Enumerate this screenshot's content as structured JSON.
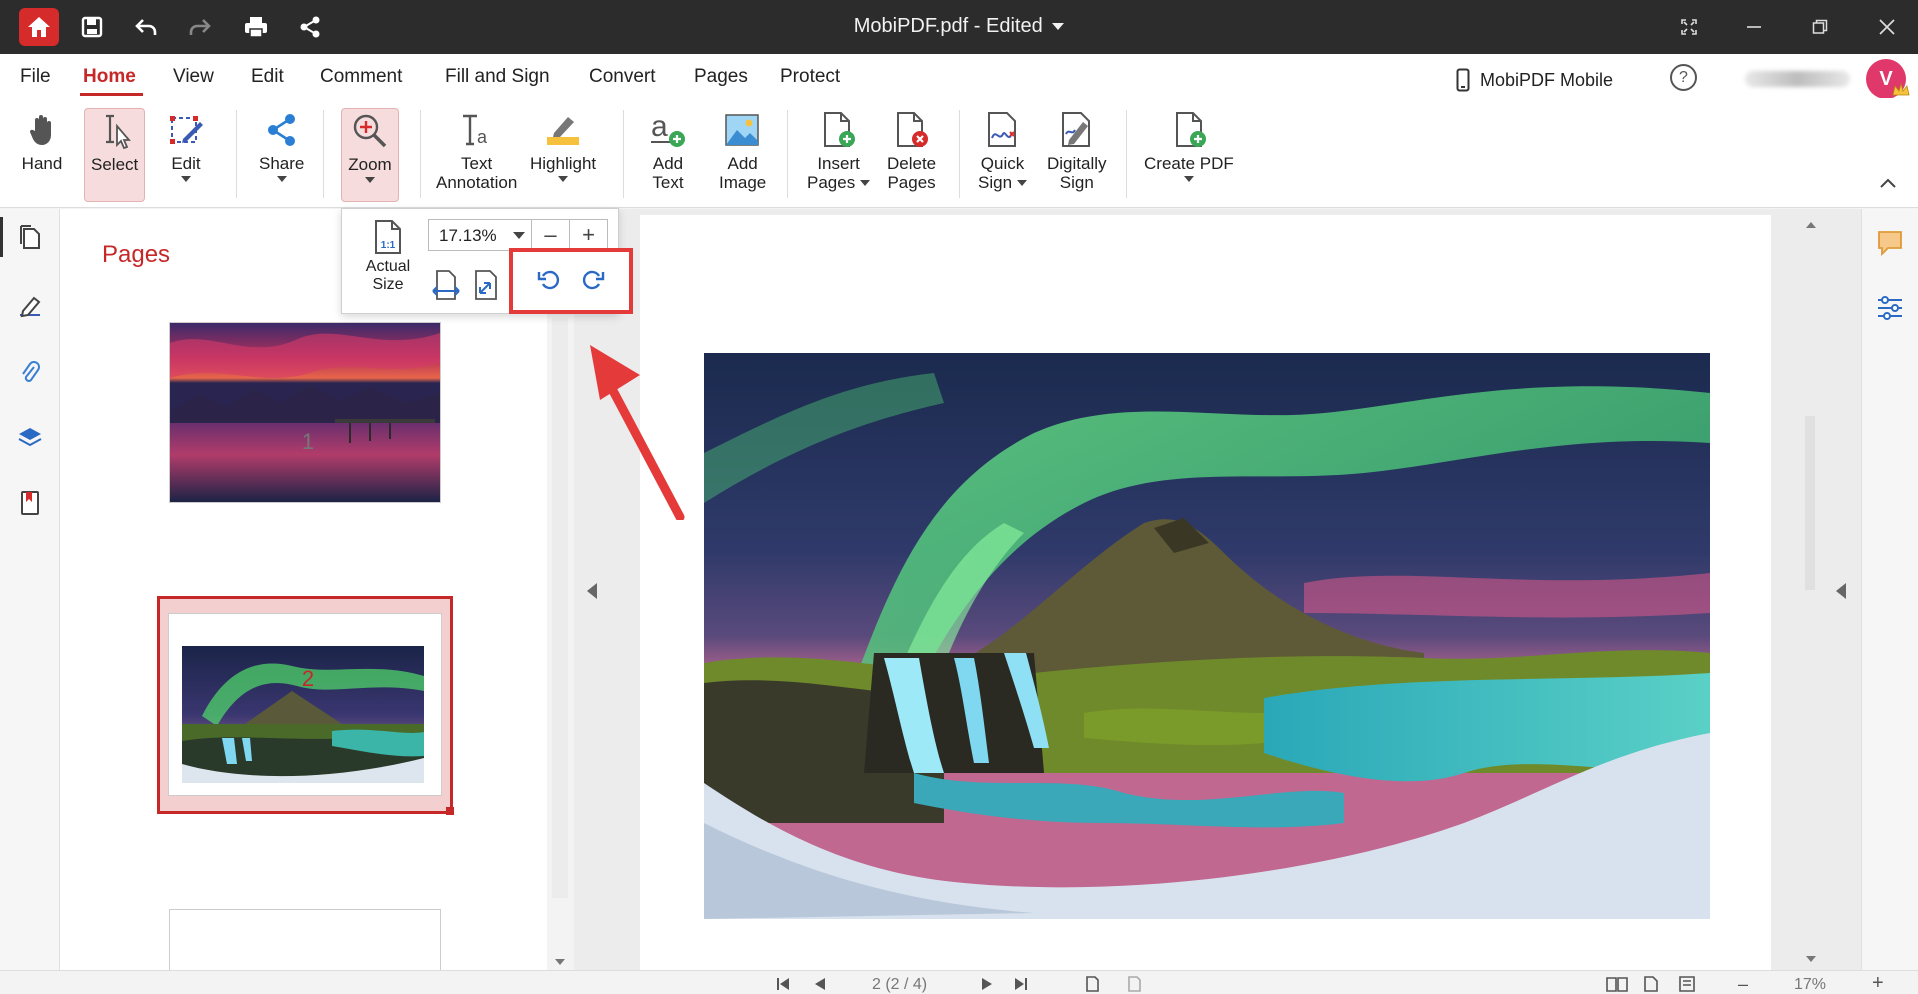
{
  "titlebar": {
    "doc_title": "MobiPDF.pdf - Edited"
  },
  "menu": {
    "items": [
      "File",
      "Home",
      "View",
      "Edit",
      "Comment",
      "Fill and Sign",
      "Convert",
      "Pages",
      "Protect"
    ],
    "active": "Home",
    "mobile_label": "MobiPDF Mobile",
    "help_label": "?",
    "avatar_initial": "V"
  },
  "toolbar": {
    "hand": "Hand",
    "select": "Select",
    "edit": "Edit",
    "share": "Share",
    "zoom": "Zoom",
    "text_annotation_1": "Text",
    "text_annotation_2": "Annotation",
    "highlight": "Highlight",
    "add_text_1": "Add",
    "add_text_2": "Text",
    "add_image_1": "Add",
    "add_image_2": "Image",
    "insert_pages_1": "Insert",
    "insert_pages_2": "Pages",
    "delete_pages_1": "Delete",
    "delete_pages_2": "Pages",
    "quick_sign_1": "Quick",
    "quick_sign_2": "Sign",
    "digitally_sign_1": "Digitally",
    "digitally_sign_2": "Sign",
    "create_pdf": "Create PDF"
  },
  "zoom_popup": {
    "actual_size_1": "Actual",
    "actual_size_2": "Size",
    "actual_icon_text": "1:1",
    "zoom_value": "17.13%",
    "minus": "–",
    "plus": "+"
  },
  "pages_panel": {
    "title": "Pages",
    "page_numbers": [
      "1",
      "2"
    ],
    "selected_page": "2"
  },
  "statusbar": {
    "page_indicator": "2 (2 / 4)",
    "zoom_level": "17%"
  },
  "colors": {
    "accent": "#c62828",
    "highlight_box": "#e53a3a",
    "titlebar": "#2c2c2c"
  }
}
